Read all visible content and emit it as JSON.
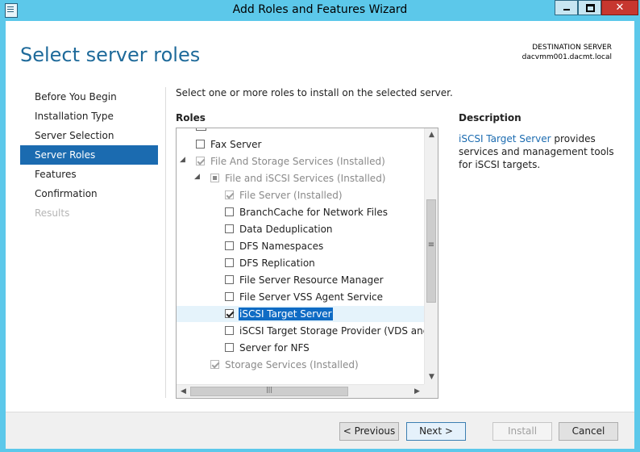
{
  "window": {
    "title": "Add Roles and Features Wizard"
  },
  "header": {
    "page_title": "Select server roles",
    "destination_label": "DESTINATION SERVER",
    "destination_server": "dacvmm001.dacmt.local"
  },
  "nav": {
    "items": [
      {
        "label": "Before You Begin",
        "state": "normal"
      },
      {
        "label": "Installation Type",
        "state": "normal"
      },
      {
        "label": "Server Selection",
        "state": "normal"
      },
      {
        "label": "Server Roles",
        "state": "active"
      },
      {
        "label": "Features",
        "state": "normal"
      },
      {
        "label": "Confirmation",
        "state": "normal"
      },
      {
        "label": "Results",
        "state": "disabled"
      }
    ]
  },
  "main": {
    "instruction": "Select one or more roles to install on the selected server.",
    "roles_heading": "Roles",
    "description_heading": "Description",
    "description_link": "iSCSI Target Server",
    "description_text": " provides services and management tools for iSCSI targets."
  },
  "roles": [
    {
      "label": "Fax Server",
      "checked": false,
      "installed": false
    },
    {
      "label": "File And Storage Services (Installed)",
      "checked": true,
      "installed": true,
      "expander": "▲"
    },
    {
      "label": "File and iSCSI Services (Installed)",
      "checked": "partial",
      "installed": true,
      "expander": "▲"
    },
    {
      "label": "File Server (Installed)",
      "checked": true,
      "installed": true
    },
    {
      "label": "BranchCache for Network Files",
      "checked": false,
      "installed": false
    },
    {
      "label": "Data Deduplication",
      "checked": false,
      "installed": false
    },
    {
      "label": "DFS Namespaces",
      "checked": false,
      "installed": false
    },
    {
      "label": "DFS Replication",
      "checked": false,
      "installed": false
    },
    {
      "label": "File Server Resource Manager",
      "checked": false,
      "installed": false
    },
    {
      "label": "File Server VSS Agent Service",
      "checked": false,
      "installed": false
    },
    {
      "label": "iSCSI Target Server",
      "checked": true,
      "installed": false,
      "selected": true
    },
    {
      "label": "iSCSI Target Storage Provider (VDS and VSS",
      "checked": false,
      "installed": false
    },
    {
      "label": "Server for NFS",
      "checked": false,
      "installed": false
    },
    {
      "label": "Storage Services (Installed)",
      "checked": true,
      "installed": true
    }
  ],
  "footer": {
    "previous": "< Previous",
    "next": "Next >",
    "install": "Install",
    "cancel": "Cancel"
  }
}
